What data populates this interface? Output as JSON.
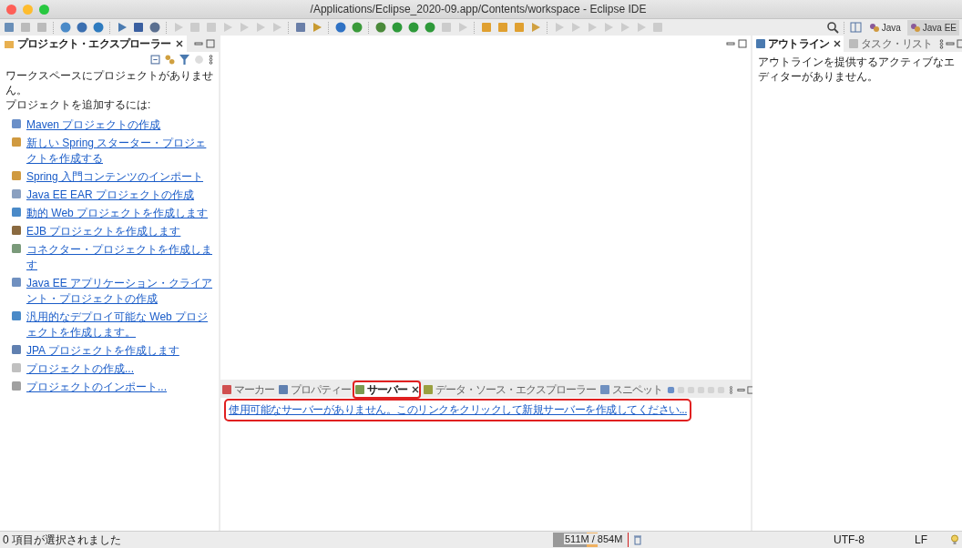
{
  "window": {
    "title": "/Applications/Eclipse_2020-09.app/Contents/workspace - Eclipse IDE"
  },
  "perspectives": [
    {
      "label": "Java",
      "selected": false
    },
    {
      "label": "Java EE",
      "selected": true
    }
  ],
  "explorer": {
    "tabs": [
      {
        "label": "プロジェクト・エクスプローラー",
        "selected": true
      }
    ],
    "lines": [
      "ワークスペースにプロジェクトがありません。",
      "プロジェクトを追加するには:"
    ],
    "links": [
      "Maven プロジェクトの作成",
      "新しい Spring スターター・プロジェクトを作成する",
      "Spring 入門コンテンツのインポート",
      "Java EE EAR プロジェクトの作成",
      "動的 Web プロジェクトを作成します",
      "EJB プロジェクトを作成します",
      "コネクター・プロジェクトを作成します",
      "Java EE アプリケーション・クライアント・プロジェクトの作成",
      "汎用的なデプロイ可能な Web プロジェクトを作成します。",
      "JPA プロジェクトを作成します",
      "プロジェクトの作成...",
      "プロジェクトのインポート..."
    ]
  },
  "outline": {
    "tabs": [
      {
        "label": "アウトライン",
        "selected": true
      },
      {
        "label": "タスク・リスト",
        "selected": false
      }
    ],
    "message": "アウトラインを提供するアクティブなエディターがありません。"
  },
  "bottom": {
    "tabs": [
      {
        "label": "マーカー",
        "selected": false,
        "highlighted": false
      },
      {
        "label": "プロパティー",
        "selected": false,
        "highlighted": false
      },
      {
        "label": "サーバー",
        "selected": true,
        "highlighted": true
      },
      {
        "label": "データ・ソース・エクスプローラー",
        "selected": false,
        "highlighted": false
      },
      {
        "label": "スニペット",
        "selected": false,
        "highlighted": false
      }
    ],
    "link": {
      "text": "使用可能なサーバーがありません。このリンクをクリックして新規サーバーを作成してください...",
      "highlighted": true
    }
  },
  "status_bar": {
    "selection": "0 項目が選択されました",
    "heap": {
      "reading": "511M / 854M",
      "level": 0.6
    },
    "encoding": "UTF-8",
    "line_ending": "LF"
  }
}
